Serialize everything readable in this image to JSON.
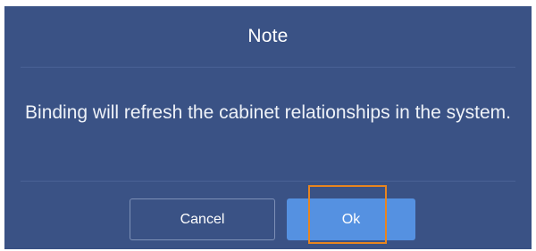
{
  "dialog": {
    "title": "Note",
    "message": "Binding will refresh the cabinet relationships in the system.",
    "cancel_label": "Cancel",
    "ok_label": "Ok"
  },
  "colors": {
    "dialog_background": "#3a5285",
    "ok_button": "#5591e1",
    "cancel_border": "#7d90b6",
    "highlight_border": "#e8851f"
  }
}
